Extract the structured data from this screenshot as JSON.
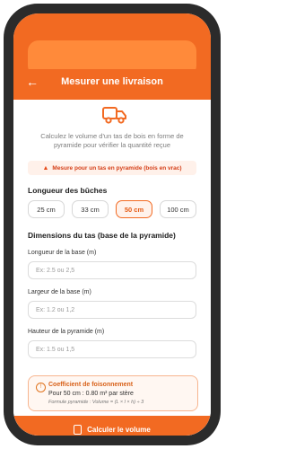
{
  "header": {
    "title": "Mesurer une livraison",
    "back_icon": "arrow-left-icon"
  },
  "description": "Calculez le volume d'un tas de bois en forme de pyramide pour vérifier la quantité reçue",
  "warning": {
    "text": "Mesure pour un tas en pyramide (bois en vrac)",
    "icon": "warning-triangle-icon"
  },
  "log_length": {
    "title": "Longueur des bûches",
    "options": [
      "25 cm",
      "33 cm",
      "50 cm",
      "100 cm"
    ],
    "selected": "50 cm"
  },
  "dimensions": {
    "title": "Dimensions du tas (base de la pyramide)",
    "fields": [
      {
        "label": "Longueur de la base (m)",
        "placeholder": "Ex: 2.5 ou 2,5"
      },
      {
        "label": "Largeur de la base (m)",
        "placeholder": "Ex: 1.2 ou 1,2"
      },
      {
        "label": "Hauteur de la pyramide (m)",
        "placeholder": "Ex: 1.5 ou 1,5"
      }
    ]
  },
  "info": {
    "title": "Coefficient de foisonnement",
    "line": "Pour 50 cm : 0.80 m³ par stère",
    "formula": "Formule pyramide : Volume = (L × l × h) ÷ 3"
  },
  "cta": {
    "label": "Calculer le volume"
  },
  "colors": {
    "accent": "#f26a22",
    "warning_text": "#d54019"
  }
}
